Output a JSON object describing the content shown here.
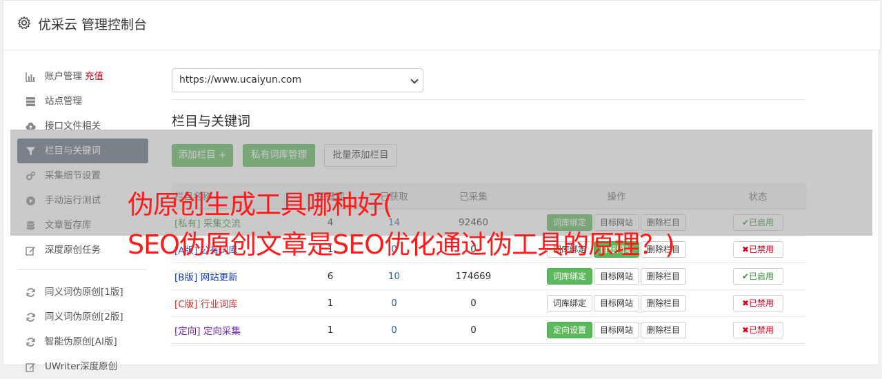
{
  "header": {
    "title": "优采云 管理控制台",
    "icon": "gear-icon"
  },
  "sidebar": {
    "items": [
      {
        "label": "账户管理",
        "extra": "充值",
        "icon": "bar-chart-icon"
      },
      {
        "label": "站点管理",
        "icon": "server-icon"
      },
      {
        "label": "接口文件相关",
        "icon": "cloud-upload-icon"
      },
      {
        "label": "栏目与关键词",
        "icon": "filter-icon",
        "active": true
      },
      {
        "label": "采集细节设置",
        "icon": "cogs-icon"
      },
      {
        "label": "手动运行测试",
        "icon": "play-circle-icon"
      },
      {
        "label": "文章暂存库",
        "icon": "database-icon"
      },
      {
        "label": "深度原创任务",
        "icon": "edit-icon"
      }
    ],
    "items2": [
      {
        "label": "同义词伪原创[1版]",
        "icon": "refresh-icon"
      },
      {
        "label": "同义词伪原创[2版]",
        "icon": "refresh-icon"
      },
      {
        "label": "智能伪原创[AI版]",
        "icon": "refresh-icon"
      },
      {
        "label": "UWriter深度原创",
        "icon": "edit-icon"
      }
    ]
  },
  "main": {
    "site_select": {
      "value": "https://www.ucaiyun.com"
    },
    "section_title": "栏目与关键词",
    "toolbar": {
      "add_column": "添加栏目 +",
      "private_lexicon": "私有词库管理",
      "batch_add": "批量添加栏目"
    },
    "table": {
      "headers": [
        "栏目名称",
        "关键词",
        "已获取",
        "已采集",
        "操作",
        "状态"
      ],
      "rows": [
        {
          "tag": "[私有]",
          "name": "采集交流",
          "col2": "4",
          "col3": "14",
          "collected": "92460",
          "op1": "词库绑定",
          "op2": "目标网站",
          "op3": "删除栏目",
          "status": "✔已启用"
        },
        {
          "tag": "[A版]",
          "name": "公有词库",
          "col2": "1",
          "col3": "0",
          "collected": "0",
          "op1": "词库绑定",
          "op2": "目标网站",
          "op3": "删除栏目",
          "status": "✖已禁用"
        },
        {
          "tag": "[B版]",
          "name": "网站更新",
          "col2": "6",
          "col3": "10",
          "collected": "174669",
          "op1": "词库绑定",
          "op2": "目标网站",
          "op3": "删除栏目",
          "status": "✔已启用"
        },
        {
          "tag": "[C版]",
          "name": "行业词库",
          "col2": "1",
          "col3": "0",
          "collected": "0",
          "op1": "词库绑定",
          "op2": "目标网站",
          "op3": "删除栏目",
          "status": "✖已禁用"
        },
        {
          "tag": "[定向]",
          "name": "定向采集",
          "col2": "1",
          "col3": "0",
          "collected": "0",
          "op1": "定向设置",
          "op2": "目标网站",
          "op3": "删除栏目",
          "status": "✖已禁用"
        }
      ]
    }
  },
  "overlay_title": {
    "line1": "伪原创生成工具哪种好(",
    "line2": "SEO伪原创文章是SEO优化通过伪工具的原理？)"
  }
}
